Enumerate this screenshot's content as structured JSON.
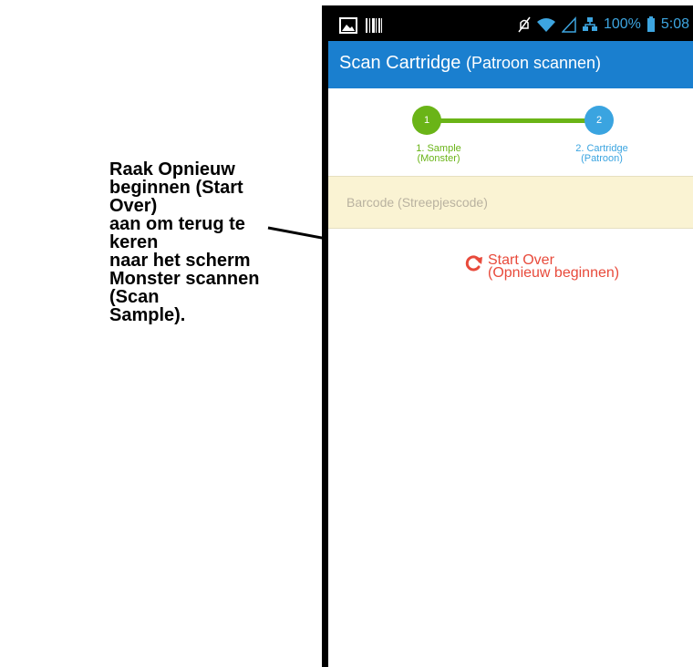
{
  "annotation": {
    "lines": [
      "Raak Opnieuw",
      "beginnen (Start Over)",
      "aan om terug te keren",
      "naar het scherm",
      "Monster scannen (Scan",
      "Sample)."
    ]
  },
  "status_bar": {
    "battery": "100%",
    "time": "5:08"
  },
  "app_bar": {
    "title": "Scan Cartridge",
    "subtitle": "(Patroon scannen)"
  },
  "stepper": {
    "steps": [
      {
        "number": "1",
        "label": "1. Sample",
        "sublabel": "(Monster)"
      },
      {
        "number": "2",
        "label": "2. Cartridge",
        "sublabel": "(Patroon)"
      }
    ]
  },
  "barcode": {
    "label": "Barcode",
    "sublabel": "(Streepjescode)"
  },
  "start_over": {
    "label": "Start Over",
    "sublabel": "(Opnieuw beginnen)"
  },
  "colors": {
    "app_bar": "#1a7fcf",
    "step_complete": "#6ab417",
    "step_active": "#3aa4e0",
    "start_over": "#e84a3b",
    "barcode_bg": "#faf3d3"
  }
}
